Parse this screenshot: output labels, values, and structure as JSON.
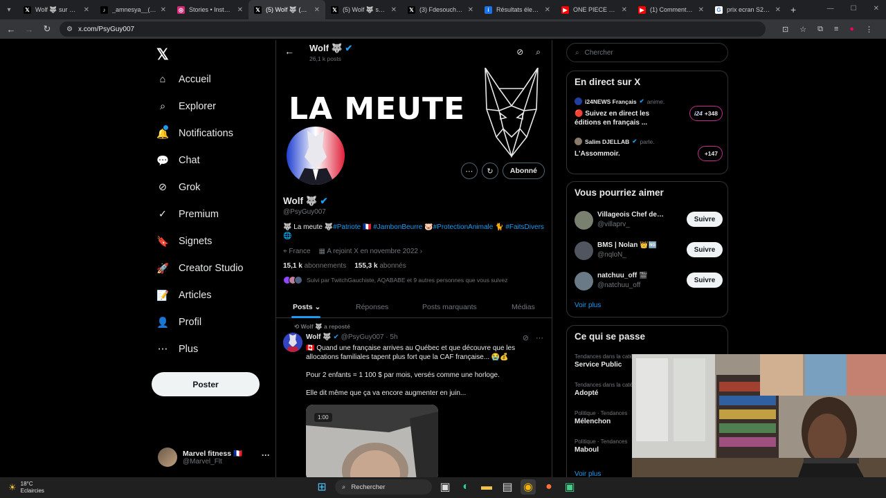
{
  "browser": {
    "tabs": [
      {
        "title": "Wolf 🐺 sur X : \"«",
        "icon": "x-icon",
        "bg": "#000",
        "fg": "#fff",
        "glyph": "𝕏"
      },
      {
        "title": "_amnesya__(@_a",
        "icon": "tiktok-icon",
        "bg": "#000",
        "fg": "#fff",
        "glyph": "♪"
      },
      {
        "title": "Stories • Instagram",
        "icon": "instagram-icon",
        "bg": "#d62976",
        "fg": "#fff",
        "glyph": "◎"
      },
      {
        "title": "(5) Wolf 🐺 (@Ps",
        "icon": "x-icon",
        "bg": "#000",
        "fg": "#fff",
        "glyph": "𝕏"
      },
      {
        "title": "(5) Wolf 🐺 sur X",
        "icon": "x-icon",
        "bg": "#000",
        "fg": "#fff",
        "glyph": "𝕏"
      },
      {
        "title": "(3) Fdesouche.com",
        "icon": "x-icon",
        "bg": "#000",
        "fg": "#fff",
        "glyph": "𝕏"
      },
      {
        "title": "Résultats élection",
        "icon": "site-icon",
        "bg": "#1a73e8",
        "fg": "#fff",
        "glyph": "i"
      },
      {
        "title": "ONE PIECE 1181",
        "icon": "youtube-icon",
        "bg": "#ff0000",
        "fg": "#fff",
        "glyph": "▶"
      },
      {
        "title": "(1) Comment répa",
        "icon": "youtube-icon",
        "bg": "#ff0000",
        "fg": "#fff",
        "glyph": "▶"
      },
      {
        "title": "prix ecran S23 - R",
        "icon": "google-icon",
        "bg": "#fff",
        "fg": "#4285f4",
        "glyph": "G"
      }
    ],
    "active_tab": 3,
    "url": "x.com/PsyGuy007"
  },
  "nav": {
    "items": [
      {
        "label": "Accueil",
        "icon": "home-icon",
        "glyph": "⌂"
      },
      {
        "label": "Explorer",
        "icon": "search-icon",
        "glyph": "⌕"
      },
      {
        "label": "Notifications",
        "icon": "bell-icon",
        "glyph": "🔔"
      },
      {
        "label": "Chat",
        "icon": "chat-icon",
        "glyph": "💬"
      },
      {
        "label": "Grok",
        "icon": "grok-icon",
        "glyph": "⊘"
      },
      {
        "label": "Premium",
        "icon": "premium-icon",
        "glyph": "✓"
      },
      {
        "label": "Signets",
        "icon": "bookmark-icon",
        "glyph": "🔖"
      },
      {
        "label": "Creator Studio",
        "icon": "rocket-icon",
        "glyph": "🚀"
      },
      {
        "label": "Articles",
        "icon": "article-icon",
        "glyph": "📝"
      },
      {
        "label": "Profil",
        "icon": "profile-icon",
        "glyph": "👤"
      },
      {
        "label": "Plus",
        "icon": "more-circle-icon",
        "glyph": "⋯"
      }
    ],
    "post_label": "Poster",
    "account": {
      "name": "Marvel fitness 🇫🇷",
      "handle": "@Marvel_Flt"
    }
  },
  "profile": {
    "topbar_name": "Wolf 🐺",
    "topbar_posts": "26,1 k posts",
    "banner_text": "LA MEUTE",
    "follow_state": "Abonné",
    "name": "Wolf 🐺",
    "handle": "@PsyGuy007",
    "bio_parts": [
      {
        "text": "🐺 La meute 🐺",
        "tag": false
      },
      {
        "text": "#Patriote",
        "tag": true
      },
      {
        "text": " 🇫🇷 ",
        "tag": false
      },
      {
        "text": "#JambonBeurre",
        "tag": true
      },
      {
        "text": " 🐷",
        "tag": false
      },
      {
        "text": "#ProtectionAnimale",
        "tag": true
      },
      {
        "text": " 🐈 ",
        "tag": false
      },
      {
        "text": "#FaitsDivers",
        "tag": true
      },
      {
        "text": " 🌐",
        "tag": false
      }
    ],
    "location": "France",
    "joined": "A rejoint X en novembre 2022",
    "following_count": "15,1 k",
    "following_label": "abonnements",
    "followers_count": "155,3 k",
    "followers_label": "abonnés",
    "followed_by": "Suivi par TwitchGauchiste, AQABABE et 9 autres personnes que vous suivez",
    "tabs": [
      "Posts",
      "Réponses",
      "Posts marquants",
      "Médias"
    ]
  },
  "tweet": {
    "repost_label": "Wolf 🐺 a reposté",
    "author": "Wolf 🐺",
    "handle_time": "@PsyGuy007 · 5h",
    "paragraphs": [
      "🇨🇦 Quand une française arrives au Québec et que découvre que les allocations familiales tapent plus fort que la CAF française... 😭💰",
      "Pour 2 enfants = 1 100 $ par mois, versés comme une horloge.",
      "Elle dit même que ça va encore augmenter en juin..."
    ],
    "media_badge": "1:00"
  },
  "right": {
    "search_placeholder": "Chercher",
    "live_title": "En direct sur X",
    "live": [
      {
        "host": "i24NEWS Français",
        "role": "anime.",
        "title": "🔴 Suivez en direct les éditions en français ...",
        "pill": "+348",
        "pill_logo": "i24"
      },
      {
        "host": "Salim DJELLAB",
        "role": "parle.",
        "title": "L'Assommoir.",
        "pill": "+147",
        "pill_logo": ""
      }
    ],
    "suggest_title": "Vous pourriez aimer",
    "suggestions": [
      {
        "name": "Villageois Chef de Hoe...",
        "handle": "@villaprv_"
      },
      {
        "name": "BMS | Nolan 👑🆖",
        "handle": "@nqloN_"
      },
      {
        "name": "natchuu_off 🎬",
        "handle": "@natchuu_off"
      }
    ],
    "follow_label": "Suivre",
    "see_more": "Voir plus",
    "trends_title": "Ce qui se passe",
    "trends": [
      {
        "cat": "Tendances dans la catégorie France",
        "name": "Service Public"
      },
      {
        "cat": "Tendances dans la catégorie France",
        "name": "Adopté"
      },
      {
        "cat": "Politique · Tendances",
        "name": "Mélenchon"
      },
      {
        "cat": "Politique · Tendances",
        "name": "Maboul"
      }
    ],
    "see_more_2": "Voir plus"
  },
  "taskbar": {
    "temp": "18°C",
    "weather": "Eclaircies",
    "search": "Rechercher"
  }
}
